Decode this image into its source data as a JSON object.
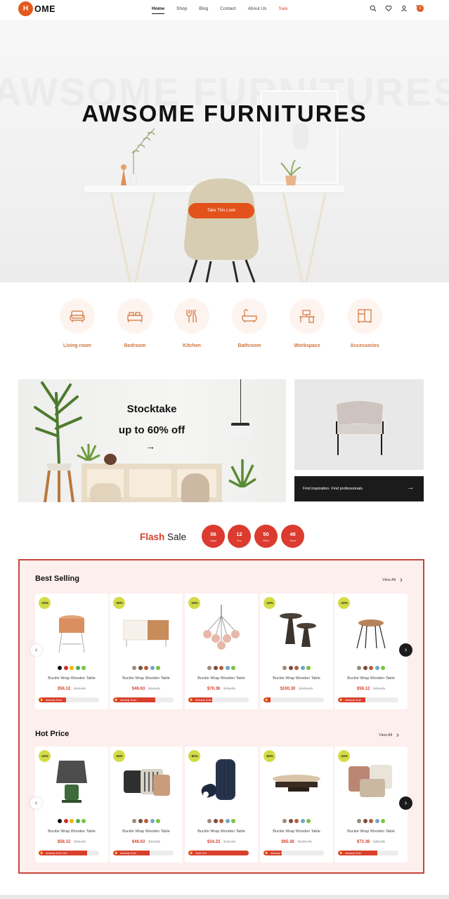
{
  "header": {
    "logo_mark": "H",
    "logo_text": "OME",
    "nav": [
      {
        "label": "Home"
      },
      {
        "label": "Shop"
      },
      {
        "label": "Blog"
      },
      {
        "label": "Contact"
      },
      {
        "label": "About Us"
      },
      {
        "label": "Sale"
      }
    ],
    "cart_count": "0",
    "icons": [
      "search-icon",
      "heart-icon",
      "user-icon",
      "cart-icon"
    ]
  },
  "hero": {
    "bg_text": "AWSOME FURNITURES",
    "title": "AWSOME FURNITURES",
    "cta": "Take This Look"
  },
  "categories": [
    {
      "label": "Living room",
      "icon": "armchair-icon"
    },
    {
      "label": "Bedroom",
      "icon": "bed-icon"
    },
    {
      "label": "Kitchen",
      "icon": "utensils-icon"
    },
    {
      "label": "Bathroom",
      "icon": "bathtub-icon"
    },
    {
      "label": "Workspace",
      "icon": "desk-icon"
    },
    {
      "label": "Accessories",
      "icon": "cabinet-icon"
    }
  ],
  "promo": {
    "line1": "Stocktake",
    "line2": "up to 60% off",
    "arrow": "→",
    "side_text": "Find inspiration. Find professionals",
    "side_arrow": "→"
  },
  "flash_sale": {
    "word1": "Flash",
    "word2": "Sale",
    "timer": [
      {
        "value": "06",
        "unit": "Days"
      },
      {
        "value": "12",
        "unit": "Hrs"
      },
      {
        "value": "50",
        "unit": "Mins"
      },
      {
        "value": "48",
        "unit": "Secs"
      }
    ]
  },
  "best_selling": {
    "title": "Best Selling",
    "view_all": "View All",
    "products": [
      {
        "discount": "-10%",
        "name": "Buckle Wrap Wooden Table",
        "price": "$56.12",
        "old_price": "$69.55",
        "sold_label": "Already Sold",
        "progress": 0.45,
        "kind": "stool"
      },
      {
        "discount": "-30%",
        "name": "Buckle Wrap Wooden Table",
        "price": "$46.63",
        "old_price": "$63.35",
        "sold_label": "Already Sold",
        "progress": 0.7,
        "kind": "sideboard"
      },
      {
        "discount": "-10%",
        "name": "Buckle Wrap Wooden Table",
        "price": "$70.36",
        "old_price": "$75.35",
        "sold_label": "Already Sold",
        "progress": 0.4,
        "kind": "lamp"
      },
      {
        "discount": "-10%",
        "name": "Buckle Wrap Wooden Table",
        "price": "$100.30",
        "old_price": "$105.35",
        "sold_label": "Already Sold",
        "progress": 0.0,
        "kind": "tables"
      },
      {
        "discount": "-10%",
        "name": "Buckle Wrap Wooden Table",
        "price": "$56.12",
        "old_price": "$69.55",
        "sold_label": "Already Sold",
        "progress": 0.45,
        "kind": "stool2"
      }
    ]
  },
  "hot_price": {
    "title": "Hot Price",
    "view_all": "View All",
    "products": [
      {
        "discount": "-10%",
        "name": "Buckle Wrap Wooden Table",
        "price": "$56.12",
        "old_price": "$69.55",
        "sold_label": "Already Sold: 6/3",
        "progress": 0.8,
        "kind": "tablelamp"
      },
      {
        "discount": "-30%",
        "name": "Buckle Wrap Wooden Table",
        "price": "$46.63",
        "old_price": "$50.55",
        "sold_label": "Already Sold",
        "progress": 0.6,
        "kind": "pillows"
      },
      {
        "discount": "-50%",
        "name": "Buckle Wrap Wooden Table",
        "price": "$34.23",
        "old_price": "$43.15",
        "sold_label": "Sold Out",
        "progress": 1.0,
        "kind": "vase"
      },
      {
        "discount": "-50%",
        "name": "Buckle Wrap Wooden Table",
        "price": "$65.36",
        "old_price": "$130.75",
        "sold_label": "Already Sold",
        "progress": 0.3,
        "kind": "coffeetable"
      },
      {
        "discount": "-10%",
        "name": "Buckle Wrap Wooden Table",
        "price": "$72.36",
        "old_price": "$85.35",
        "sold_label": "Already Sold",
        "progress": 0.65,
        "kind": "pillows2"
      }
    ]
  },
  "swatch_colors": [
    "#111111",
    "#d12f2f",
    "#f4b400",
    "#4caf50",
    "#7cc242"
  ],
  "swatch_colors_alt": [
    "#9a8a7e",
    "#7a4b3a",
    "#b85c3c",
    "#6fa8c7",
    "#7cc242"
  ],
  "accent": "#e3521b"
}
